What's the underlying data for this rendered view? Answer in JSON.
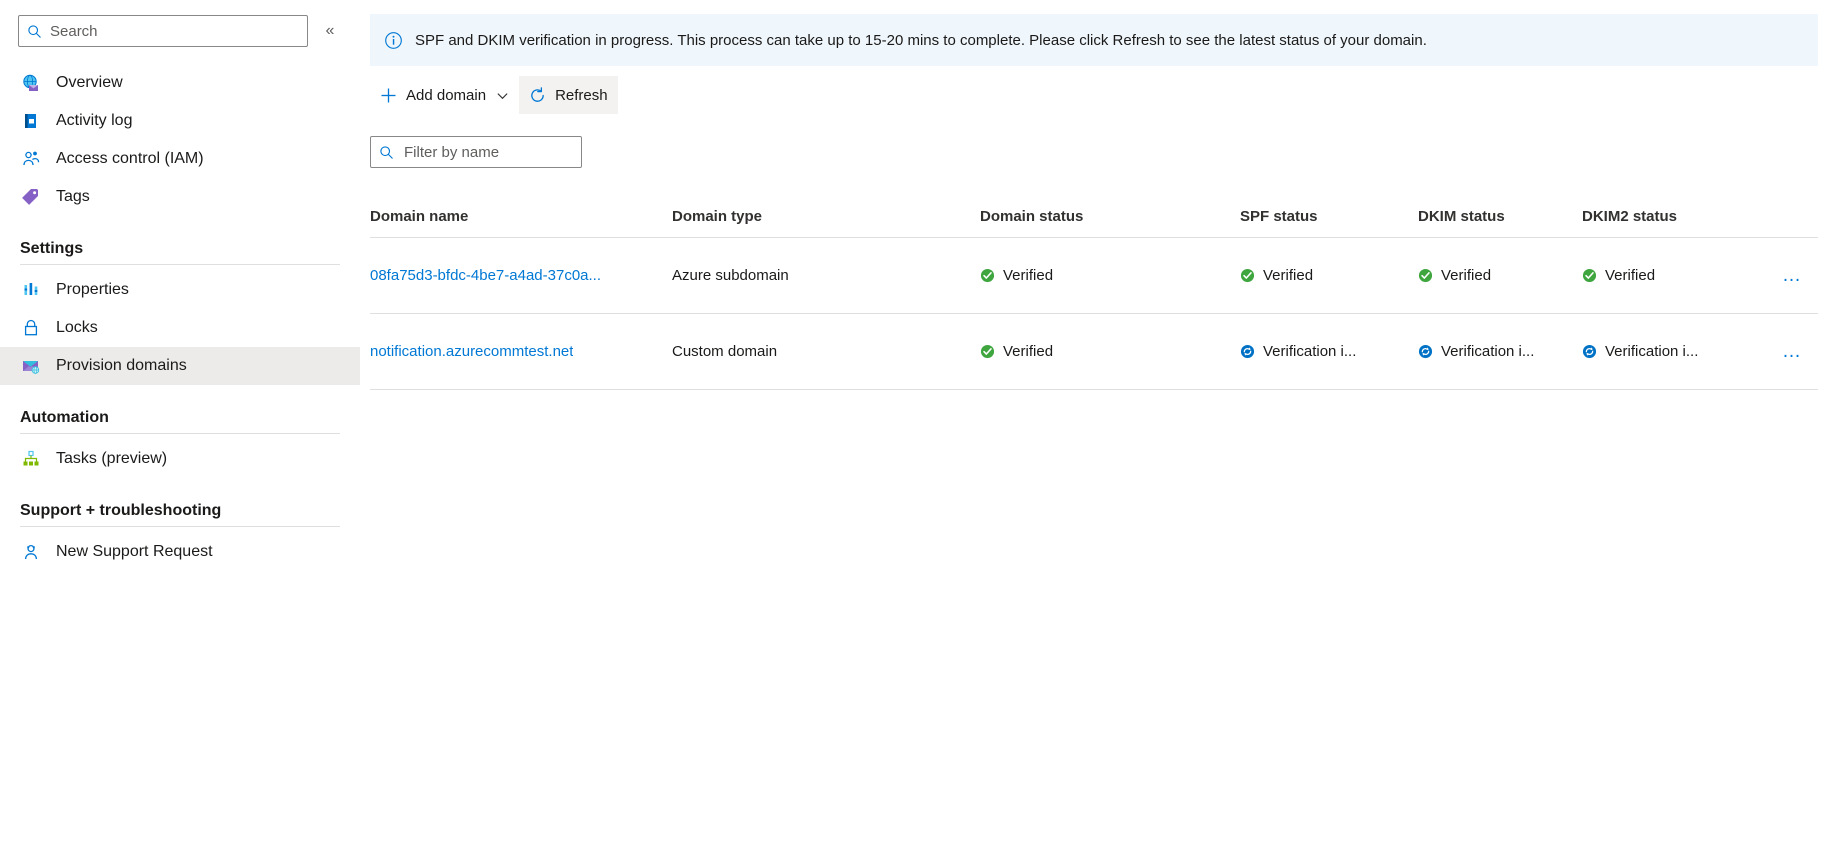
{
  "sidebar": {
    "search": {
      "placeholder": "Search",
      "value": "",
      "icon": "search-icon"
    },
    "collapse": {
      "icon": "chevron-double-left-icon",
      "glyph": "«"
    },
    "items": [
      {
        "label": "Overview",
        "icon": "overview-globe-mail-icon",
        "selected": false
      },
      {
        "label": "Activity log",
        "icon": "activity-log-icon",
        "selected": false
      },
      {
        "label": "Access control (IAM)",
        "icon": "access-control-people-icon",
        "selected": false
      },
      {
        "label": "Tags",
        "icon": "tag-icon",
        "selected": false
      }
    ],
    "groups": [
      {
        "title": "Settings",
        "items": [
          {
            "label": "Properties",
            "icon": "properties-bars-icon",
            "selected": false
          },
          {
            "label": "Locks",
            "icon": "lock-icon",
            "selected": false
          },
          {
            "label": "Provision domains",
            "icon": "provision-domains-envelope-icon",
            "selected": true
          }
        ]
      },
      {
        "title": "Automation",
        "items": [
          {
            "label": "Tasks (preview)",
            "icon": "tasks-hierarchy-icon",
            "selected": false
          }
        ]
      },
      {
        "title": "Support + troubleshooting",
        "items": [
          {
            "label": "New Support Request",
            "icon": "support-person-icon",
            "selected": false
          }
        ]
      }
    ]
  },
  "main": {
    "banner": {
      "icon": "info-circle-icon",
      "text": "SPF and DKIM verification in progress. This process can take up to 15-20 mins to complete. Please click Refresh to see the latest status of your domain.",
      "background": "#eff6fc"
    },
    "toolbar": {
      "add_domain": {
        "label": "Add domain",
        "icon": "plus-icon",
        "chevron": "chevron-down-icon"
      },
      "refresh": {
        "label": "Refresh",
        "icon": "refresh-icon",
        "hovered": true
      }
    },
    "filter": {
      "placeholder": "Filter by name",
      "value": "",
      "icon": "search-icon"
    },
    "table": {
      "columns": [
        "Domain name",
        "Domain type",
        "Domain status",
        "SPF status",
        "DKIM status",
        "DKIM2 status"
      ],
      "rows": [
        {
          "domain_name": "08fa75d3-bfdc-4be7-a4ad-37c0a...",
          "domain_type": "Azure subdomain",
          "domain_status": {
            "text": "Verified",
            "icon": "verified-check-icon"
          },
          "spf_status": {
            "text": "Verified",
            "icon": "verified-check-icon"
          },
          "dkim_status": {
            "text": "Verified",
            "icon": "verified-check-icon"
          },
          "dkim2_status": {
            "text": "Verified",
            "icon": "verified-check-icon"
          },
          "menu": "…"
        },
        {
          "domain_name": "notification.azurecommtest.net",
          "domain_type": "Custom domain",
          "domain_status": {
            "text": "Verified",
            "icon": "verified-check-icon"
          },
          "spf_status": {
            "text": "Verification i...",
            "icon": "verification-in-progress-icon"
          },
          "dkim_status": {
            "text": "Verification i...",
            "icon": "verification-in-progress-icon"
          },
          "dkim2_status": {
            "text": "Verification i...",
            "icon": "verification-in-progress-icon"
          },
          "menu": "…"
        }
      ]
    }
  },
  "colors": {
    "accent": "#0078d4",
    "success": "#107c10",
    "in_progress": "#0072c6",
    "selected_row": "#edebe9",
    "banner_bg": "#eff6fc",
    "border": "#e1dfdd"
  }
}
